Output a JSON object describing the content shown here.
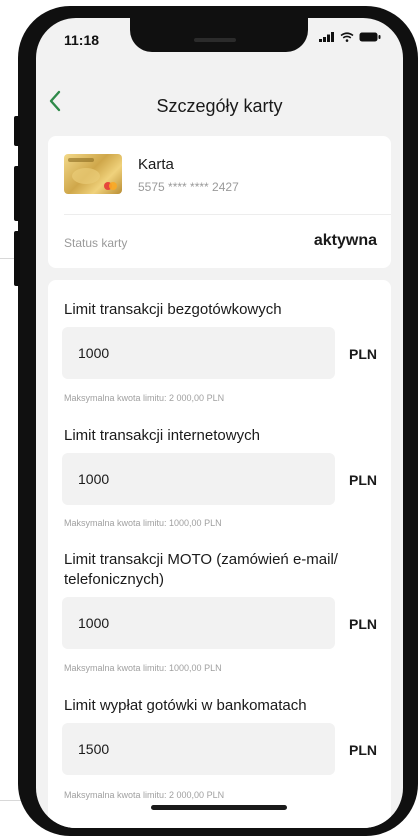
{
  "status_bar": {
    "time": "11:18"
  },
  "header": {
    "back_icon": "chevron-left-icon",
    "title": "Szczegóły karty"
  },
  "card": {
    "name": "Karta",
    "number": "5575 **** **** 2427",
    "status_label": "Status karty",
    "status_value": "aktywna"
  },
  "limits": [
    {
      "label": "Limit transakcji bezgotówkowych",
      "value": "1000",
      "currency": "PLN",
      "max": "Maksymalna kwota limitu:    2 000,00 PLN"
    },
    {
      "label": "Limit transakcji internetowych",
      "value": "1000",
      "currency": "PLN",
      "max": "Maksymalna kwota limitu: 1000,00 PLN"
    },
    {
      "label": "Limit transakcji MOTO (zamówień e-mail/ telefonicznych)",
      "value": "1000",
      "currency": "PLN",
      "max": "Maksymalna kwota limitu: 1000,00 PLN"
    },
    {
      "label": "Limit wypłat gotówki w bankomatach",
      "value": "1500",
      "currency": "PLN",
      "max": "Maksymalna kwota limitu:    2 000,00 PLN"
    }
  ],
  "colors": {
    "accent": "#2f8a4a",
    "background": "#f2f2f2",
    "frame": "#101010"
  }
}
